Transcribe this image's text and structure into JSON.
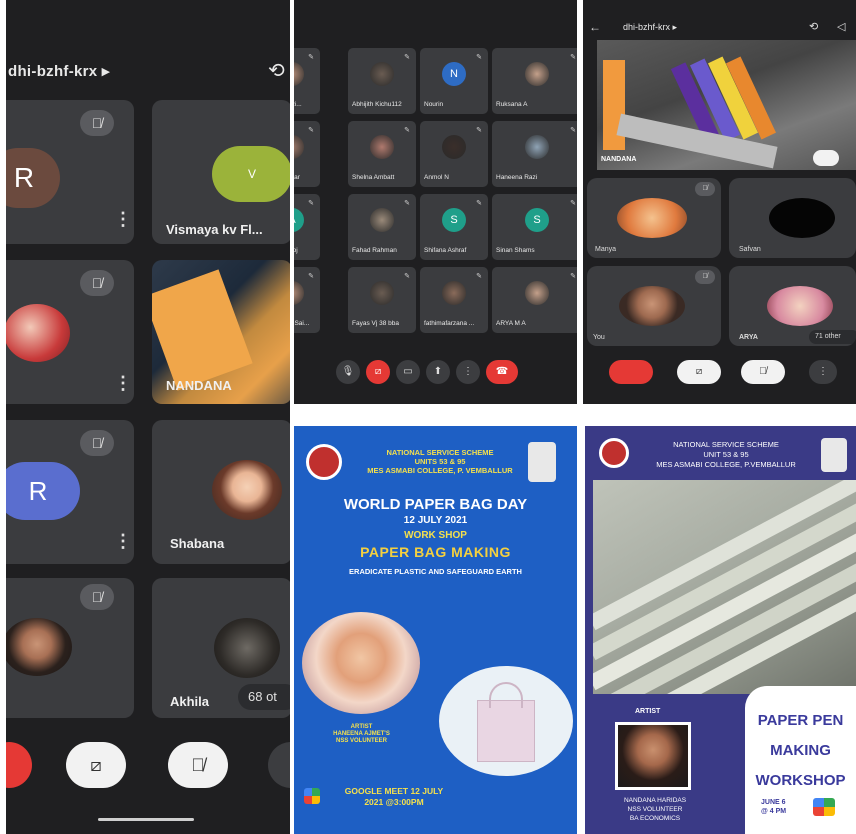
{
  "panel1": {
    "meeting_code": "dhi-bzhf-krx ▸",
    "tiles": [
      {
        "initial": "R",
        "name": ""
      },
      {
        "initial": "V",
        "name": "Vismaya kv Fl..."
      },
      {
        "initial": "",
        "name": ""
      },
      {
        "initial": "",
        "name": "NANDANA"
      },
      {
        "initial": "R",
        "name": ""
      },
      {
        "initial": "",
        "name": "Shabana"
      },
      {
        "initial": "",
        "name": ""
      },
      {
        "initial": "",
        "name": "Akhila"
      }
    ],
    "others_badge": "68 ot",
    "colors": {
      "bg": "#1f1f21",
      "tile": "#3b3c3f",
      "avatar_r1": "#6b4a3e",
      "avatar_v": "#9bb33a",
      "avatar_r2": "#5a6ecf",
      "end_call": "#e53935"
    }
  },
  "panel2": {
    "participants": [
      {
        "name": "Shazi...",
        "kind": "photo"
      },
      {
        "name": "Abhijith Kichu112",
        "kind": "photo"
      },
      {
        "name": "Nourin",
        "kind": "letter",
        "initial": "N",
        "color": "#2e6cc4"
      },
      {
        "name": "Ruksana A",
        "kind": "photo"
      },
      {
        "name": "hankar",
        "kind": "photo"
      },
      {
        "name": "Shelna Ambatt",
        "kind": "photo"
      },
      {
        "name": "Anmol N",
        "kind": "photo"
      },
      {
        "name": "Haneena Razi",
        "kind": "photo"
      },
      {
        "name": "Manoj",
        "kind": "letter",
        "initial": "A",
        "color": "#1f9f8a"
      },
      {
        "name": "Fahad Rahman",
        "kind": "photo"
      },
      {
        "name": "Shifana Ashraf",
        "kind": "letter",
        "initial": "S",
        "color": "#1f9f8a"
      },
      {
        "name": "Sinan Shams",
        "kind": "letter",
        "initial": "S",
        "color": "#1f9f8a"
      },
      {
        "name": "med Sai...",
        "kind": "photo"
      },
      {
        "name": "Fayas Vj 38 bba",
        "kind": "photo"
      },
      {
        "name": "fathimafarzana ...",
        "kind": "photo"
      },
      {
        "name": "ARYA M A",
        "kind": "photo"
      }
    ]
  },
  "panel3": {
    "meeting_code": "dhi-bzhf-krx ▸",
    "main_name": "NANDANA",
    "tiles": [
      {
        "name": "Manya"
      },
      {
        "name": "Safvan"
      },
      {
        "name": "You"
      },
      {
        "name": "ARYA"
      }
    ],
    "others_badge": "71 other"
  },
  "panel4": {
    "org": "NATIONAL SERVICE SCHEME",
    "units": "UNITS 53 & 95",
    "college": "MES ASMABI COLLEGE, P. VEMBALLUR",
    "title": "WORLD PAPER BAG DAY",
    "date": "12 JULY 2021",
    "workshop": "WORK SHOP",
    "event": "PAPER BAG MAKING",
    "tagline": "ERADICATE PLASTIC AND SAFEGUARD EARTH",
    "artist_label": "ARTIST",
    "artist_name": "HANEENA AJMET'S",
    "artist_role": "NSS VOLUNTEER",
    "meet_line1": "GOOGLE MEET 12 JULY",
    "meet_line2": "2021 @3:00PM",
    "colors": {
      "bg": "#1e5fc4",
      "yellow": "#f4e04d",
      "event": "#f4d03f"
    }
  },
  "panel5": {
    "org": "NATIONAL SERVICE SCHEME",
    "units": "UNIT 53 & 95",
    "college": "MES ASMABI COLLEGE, P.VEMBALLUR",
    "artist_label": "ARTIST",
    "title_l1": "PAPER PEN",
    "title_l2": "MAKING",
    "title_l3": "WORKSHOP",
    "date_l1": "JUNE 6",
    "date_l2": "@ 4 PM",
    "artist_name": "NANDANA HARIDAS",
    "artist_role": "NSS VOLUNTEER",
    "artist_class": "BA ECONOMICS",
    "colors": {
      "bg": "#3a3a86",
      "title": "#3a3a9c"
    }
  }
}
